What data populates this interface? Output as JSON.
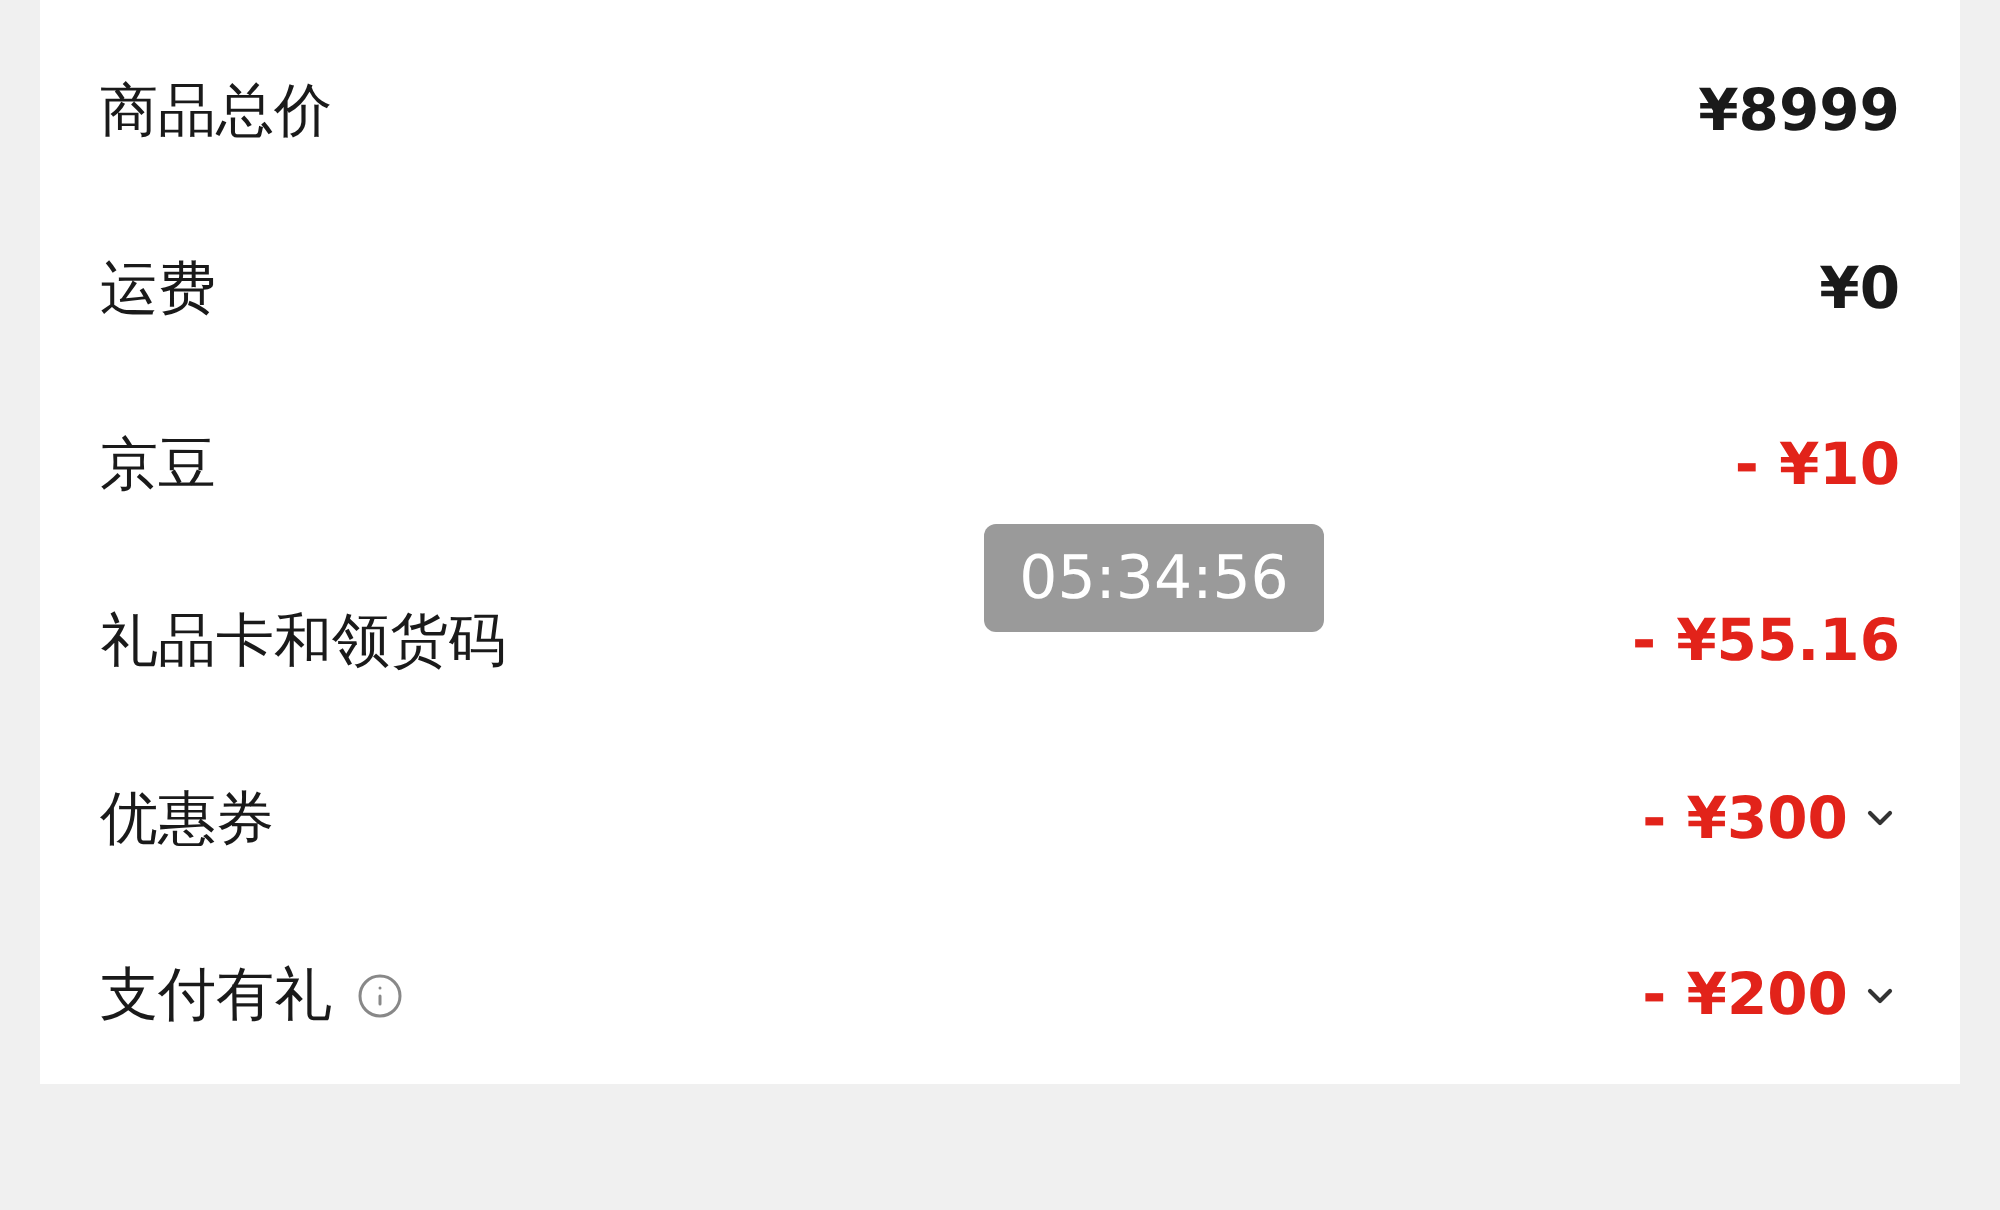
{
  "rows": [
    {
      "label": "商品总价",
      "value": "¥8999",
      "kind": "price",
      "expandable": false,
      "info": false
    },
    {
      "label": "运费",
      "value": "¥0",
      "kind": "price",
      "expandable": false,
      "info": false
    },
    {
      "label": "京豆",
      "value": "- ¥10",
      "kind": "discount",
      "expandable": false,
      "info": false
    },
    {
      "label": "礼品卡和领货码",
      "value": "- ¥55.16",
      "kind": "discount",
      "expandable": false,
      "info": false
    },
    {
      "label": "优惠券",
      "value": "- ¥300",
      "kind": "discount",
      "expandable": true,
      "info": false
    },
    {
      "label": "支付有礼",
      "value": "- ¥200",
      "kind": "discount",
      "expandable": true,
      "info": true
    }
  ],
  "timer": "05:34:56"
}
